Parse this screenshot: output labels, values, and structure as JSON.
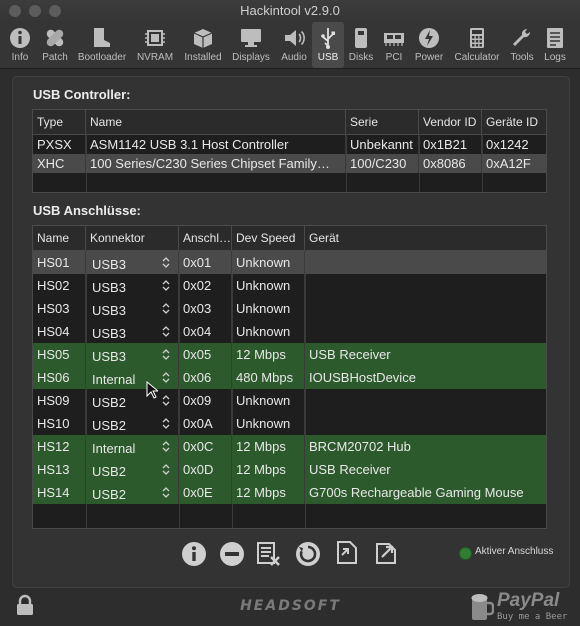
{
  "window": {
    "title": "Hackintool v2.9.0"
  },
  "toolbar": {
    "items": [
      {
        "label": "Info",
        "icon": "info-icon"
      },
      {
        "label": "Patch",
        "icon": "bandage-icon"
      },
      {
        "label": "Bootloader",
        "icon": "boot-icon"
      },
      {
        "label": "NVRAM",
        "icon": "chip-icon"
      },
      {
        "label": "Installed",
        "icon": "box-icon"
      },
      {
        "label": "Displays",
        "icon": "monitor-icon"
      },
      {
        "label": "Audio",
        "icon": "speaker-icon"
      },
      {
        "label": "USB",
        "icon": "usb-icon"
      },
      {
        "label": "Disks",
        "icon": "disk-icon"
      },
      {
        "label": "PCI",
        "icon": "pci-icon"
      },
      {
        "label": "Power",
        "icon": "power-icon"
      },
      {
        "label": "Calculator",
        "icon": "calculator-icon"
      },
      {
        "label": "Tools",
        "icon": "wrench-icon"
      },
      {
        "label": "Logs",
        "icon": "logs-icon"
      }
    ],
    "active": "USB"
  },
  "controller": {
    "title": "USB Controller:",
    "columns": [
      "Type",
      "Name",
      "Serie",
      "Vendor ID",
      "Geräte ID"
    ],
    "rows": [
      {
        "type": "PXSX",
        "name": "ASM1142 USB 3.1 Host Controller",
        "serie": "Unbekannt",
        "vendor": "0x1B21",
        "device": "0x1242"
      },
      {
        "type": "XHC",
        "name": "100 Series/C230 Series Chipset Family…",
        "serie": "100/C230",
        "vendor": "0x8086",
        "device": "0xA12F"
      }
    ]
  },
  "ports": {
    "title": "USB Anschlüsse:",
    "columns": [
      "Name",
      "Konnektor",
      "Anschl…",
      "Dev Speed",
      "Gerät"
    ],
    "rows": [
      {
        "name": "HS01",
        "connector": "USB3",
        "port": "0x01",
        "speed": "Unknown",
        "device": "",
        "active": false,
        "selected": true
      },
      {
        "name": "HS02",
        "connector": "USB3",
        "port": "0x02",
        "speed": "Unknown",
        "device": "",
        "active": false
      },
      {
        "name": "HS03",
        "connector": "USB3",
        "port": "0x03",
        "speed": "Unknown",
        "device": "",
        "active": false
      },
      {
        "name": "HS04",
        "connector": "USB3",
        "port": "0x04",
        "speed": "Unknown",
        "device": "",
        "active": false
      },
      {
        "name": "HS05",
        "connector": "USB3",
        "port": "0x05",
        "speed": "12 Mbps",
        "device": "USB Receiver",
        "active": true
      },
      {
        "name": "HS06",
        "connector": "Internal",
        "port": "0x06",
        "speed": "480 Mbps",
        "device": "IOUSBHostDevice",
        "active": true
      },
      {
        "name": "HS09",
        "connector": "USB2",
        "port": "0x09",
        "speed": "Unknown",
        "device": "",
        "active": false
      },
      {
        "name": "HS10",
        "connector": "USB2",
        "port": "0x0A",
        "speed": "Unknown",
        "device": "",
        "active": false
      },
      {
        "name": "HS12",
        "connector": "Internal",
        "port": "0x0C",
        "speed": "12 Mbps",
        "device": "BRCM20702 Hub",
        "active": true
      },
      {
        "name": "HS13",
        "connector": "USB2",
        "port": "0x0D",
        "speed": "12 Mbps",
        "device": "USB Receiver",
        "active": true
      },
      {
        "name": "HS14",
        "connector": "USB2",
        "port": "0x0E",
        "speed": "12 Mbps",
        "device": "G700s Rechargeable Gaming Mouse",
        "active": true
      }
    ]
  },
  "legend": {
    "label": "Aktiver Anschluss",
    "color": "#2f7d33"
  },
  "footer": {
    "brand": "HEADSOFT",
    "paypal": "PayPal",
    "paypal_sub": "Buy me a Beer"
  },
  "colors": {
    "active_row": "#2c5a2c",
    "selected_row": "#4a4a4a"
  }
}
